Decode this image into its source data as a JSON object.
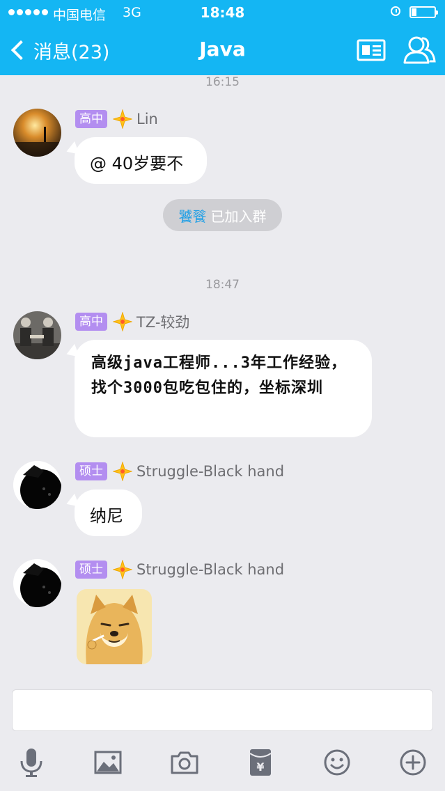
{
  "status": {
    "carrier": "中国电信",
    "network": "3G",
    "time": "18:48"
  },
  "nav": {
    "back_label": "消息(23)",
    "title": "Java"
  },
  "messages": [
    {
      "time": "16:15",
      "level": "高中",
      "nick": "Lin",
      "text": "@ 40岁要不"
    },
    {
      "system_name": "饕餮",
      "system_text": "已加入群"
    },
    {
      "time": "18:47",
      "level": "高中",
      "nick": "TZ-较劲",
      "text": "高级java工程师...3年工作经验，找个3000包吃包住的，坐标深圳"
    },
    {
      "level": "硕士",
      "nick": "Struggle-Black hand",
      "text": "纳尼"
    },
    {
      "level": "硕士",
      "nick": "Struggle-Black hand",
      "sticker": "doge-sticker"
    }
  ],
  "input": {
    "placeholder": ""
  },
  "colors": {
    "accent": "#14b6f3",
    "level_badge": "#b38ef0",
    "bg": "#ebebef",
    "star": "#ffc21a"
  },
  "toolbar_icons": [
    "microphone-icon",
    "image-icon",
    "camera-icon",
    "red-packet-icon",
    "emoji-icon",
    "plus-icon"
  ]
}
